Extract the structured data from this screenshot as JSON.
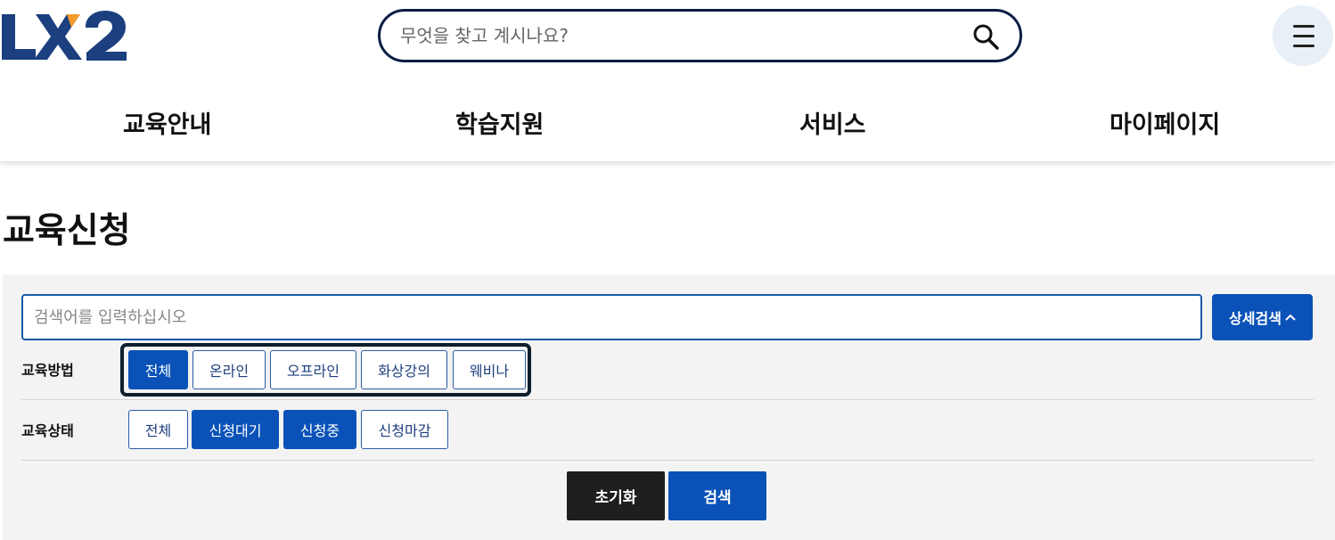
{
  "brand": {
    "logo_text": "LX2",
    "accent": "#f39a2a",
    "primary": "#1b3f7f"
  },
  "header": {
    "search_placeholder": "무엇을 찾고 계시나요?",
    "search_icon": "search-icon",
    "menu_icon": "hamburger-menu-icon"
  },
  "gnb": [
    "교육안내",
    "학습지원",
    "서비스",
    "마이페이지"
  ],
  "page": {
    "title": "교육신청"
  },
  "filter": {
    "keyword_placeholder": "검색어를 입력하십시오",
    "advanced_label": "상세검색",
    "method": {
      "label": "교육방법",
      "options": [
        "전체",
        "온라인",
        "오프라인",
        "화상강의",
        "웨비나"
      ],
      "selected": [
        "전체"
      ]
    },
    "status": {
      "label": "교육상태",
      "options": [
        "전체",
        "신청대기",
        "신청중",
        "신청마감"
      ],
      "selected": [
        "신청대기",
        "신청중"
      ]
    },
    "reset_label": "초기화",
    "search_label": "검색"
  },
  "colors": {
    "selected_chip": "#0a52b8",
    "reset_button": "#1e1e1e",
    "search_border": "#0c1d44"
  }
}
